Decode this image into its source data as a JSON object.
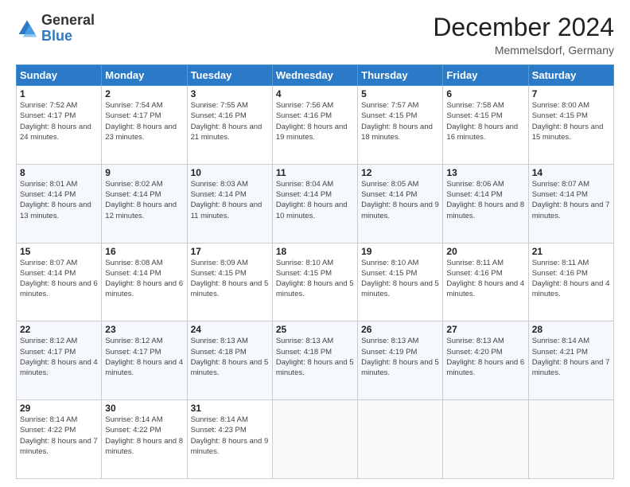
{
  "header": {
    "logo": {
      "general": "General",
      "blue": "Blue"
    },
    "title": "December 2024",
    "location": "Memmelsdorf, Germany"
  },
  "days_of_week": [
    "Sunday",
    "Monday",
    "Tuesday",
    "Wednesday",
    "Thursday",
    "Friday",
    "Saturday"
  ],
  "weeks": [
    [
      {
        "day": "1",
        "sunrise": "7:52 AM",
        "sunset": "4:17 PM",
        "daylight": "8 hours and 24 minutes."
      },
      {
        "day": "2",
        "sunrise": "7:54 AM",
        "sunset": "4:17 PM",
        "daylight": "8 hours and 23 minutes."
      },
      {
        "day": "3",
        "sunrise": "7:55 AM",
        "sunset": "4:16 PM",
        "daylight": "8 hours and 21 minutes."
      },
      {
        "day": "4",
        "sunrise": "7:56 AM",
        "sunset": "4:16 PM",
        "daylight": "8 hours and 19 minutes."
      },
      {
        "day": "5",
        "sunrise": "7:57 AM",
        "sunset": "4:15 PM",
        "daylight": "8 hours and 18 minutes."
      },
      {
        "day": "6",
        "sunrise": "7:58 AM",
        "sunset": "4:15 PM",
        "daylight": "8 hours and 16 minutes."
      },
      {
        "day": "7",
        "sunrise": "8:00 AM",
        "sunset": "4:15 PM",
        "daylight": "8 hours and 15 minutes."
      }
    ],
    [
      {
        "day": "8",
        "sunrise": "8:01 AM",
        "sunset": "4:14 PM",
        "daylight": "8 hours and 13 minutes."
      },
      {
        "day": "9",
        "sunrise": "8:02 AM",
        "sunset": "4:14 PM",
        "daylight": "8 hours and 12 minutes."
      },
      {
        "day": "10",
        "sunrise": "8:03 AM",
        "sunset": "4:14 PM",
        "daylight": "8 hours and 11 minutes."
      },
      {
        "day": "11",
        "sunrise": "8:04 AM",
        "sunset": "4:14 PM",
        "daylight": "8 hours and 10 minutes."
      },
      {
        "day": "12",
        "sunrise": "8:05 AM",
        "sunset": "4:14 PM",
        "daylight": "8 hours and 9 minutes."
      },
      {
        "day": "13",
        "sunrise": "8:06 AM",
        "sunset": "4:14 PM",
        "daylight": "8 hours and 8 minutes."
      },
      {
        "day": "14",
        "sunrise": "8:07 AM",
        "sunset": "4:14 PM",
        "daylight": "8 hours and 7 minutes."
      }
    ],
    [
      {
        "day": "15",
        "sunrise": "8:07 AM",
        "sunset": "4:14 PM",
        "daylight": "8 hours and 6 minutes."
      },
      {
        "day": "16",
        "sunrise": "8:08 AM",
        "sunset": "4:14 PM",
        "daylight": "8 hours and 6 minutes."
      },
      {
        "day": "17",
        "sunrise": "8:09 AM",
        "sunset": "4:15 PM",
        "daylight": "8 hours and 5 minutes."
      },
      {
        "day": "18",
        "sunrise": "8:10 AM",
        "sunset": "4:15 PM",
        "daylight": "8 hours and 5 minutes."
      },
      {
        "day": "19",
        "sunrise": "8:10 AM",
        "sunset": "4:15 PM",
        "daylight": "8 hours and 5 minutes."
      },
      {
        "day": "20",
        "sunrise": "8:11 AM",
        "sunset": "4:16 PM",
        "daylight": "8 hours and 4 minutes."
      },
      {
        "day": "21",
        "sunrise": "8:11 AM",
        "sunset": "4:16 PM",
        "daylight": "8 hours and 4 minutes."
      }
    ],
    [
      {
        "day": "22",
        "sunrise": "8:12 AM",
        "sunset": "4:17 PM",
        "daylight": "8 hours and 4 minutes."
      },
      {
        "day": "23",
        "sunrise": "8:12 AM",
        "sunset": "4:17 PM",
        "daylight": "8 hours and 4 minutes."
      },
      {
        "day": "24",
        "sunrise": "8:13 AM",
        "sunset": "4:18 PM",
        "daylight": "8 hours and 5 minutes."
      },
      {
        "day": "25",
        "sunrise": "8:13 AM",
        "sunset": "4:18 PM",
        "daylight": "8 hours and 5 minutes."
      },
      {
        "day": "26",
        "sunrise": "8:13 AM",
        "sunset": "4:19 PM",
        "daylight": "8 hours and 5 minutes."
      },
      {
        "day": "27",
        "sunrise": "8:13 AM",
        "sunset": "4:20 PM",
        "daylight": "8 hours and 6 minutes."
      },
      {
        "day": "28",
        "sunrise": "8:14 AM",
        "sunset": "4:21 PM",
        "daylight": "8 hours and 7 minutes."
      }
    ],
    [
      {
        "day": "29",
        "sunrise": "8:14 AM",
        "sunset": "4:22 PM",
        "daylight": "8 hours and 7 minutes."
      },
      {
        "day": "30",
        "sunrise": "8:14 AM",
        "sunset": "4:22 PM",
        "daylight": "8 hours and 8 minutes."
      },
      {
        "day": "31",
        "sunrise": "8:14 AM",
        "sunset": "4:23 PM",
        "daylight": "8 hours and 9 minutes."
      },
      null,
      null,
      null,
      null
    ]
  ]
}
